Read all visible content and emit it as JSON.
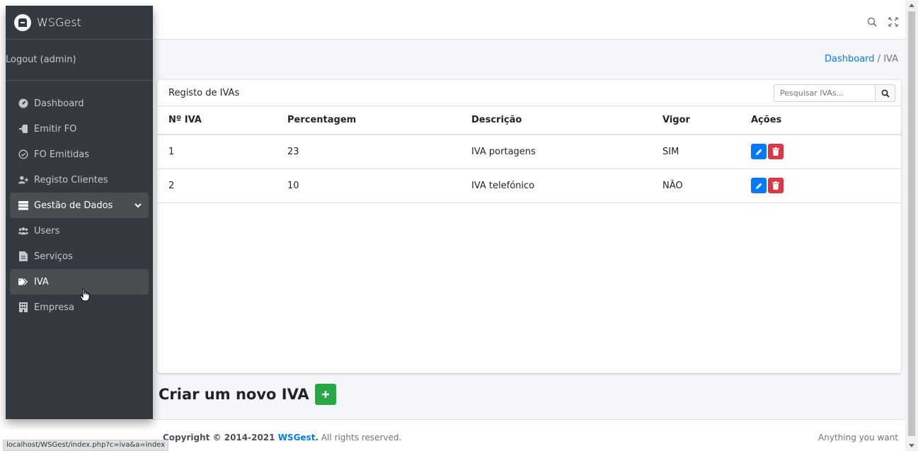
{
  "brand": {
    "name": "WSGest"
  },
  "user": {
    "logout_label": "Logout (admin)"
  },
  "sidebar": {
    "items": [
      {
        "label": "Dashboard",
        "icon": "dashboard-gauge-icon"
      },
      {
        "label": "Emitir FO",
        "icon": "sign-in-icon"
      },
      {
        "label": "FO Emitidas",
        "icon": "check-circle-icon"
      },
      {
        "label": "Registo Clientes",
        "icon": "user-plus-icon"
      },
      {
        "label": "Gestão de Dados",
        "icon": "server-icon"
      },
      {
        "label": "Users",
        "icon": "users-icon"
      },
      {
        "label": "Serviços",
        "icon": "file-icon"
      },
      {
        "label": "IVA",
        "icon": "tags-icon"
      },
      {
        "label": "Empresa",
        "icon": "building-icon"
      }
    ]
  },
  "breadcrumb": {
    "home": "Dashboard",
    "separator": "/",
    "current": "IVA"
  },
  "card": {
    "title": "Registo de IVAs",
    "search_placeholder": "Pesquisar IVAs..."
  },
  "table": {
    "headers": [
      "Nº IVA",
      "Percentagem",
      "Descrição",
      "Vigor",
      "Ações"
    ],
    "rows": [
      {
        "num": "1",
        "pct": "23",
        "desc": "IVA portagens",
        "vigor": "SIM"
      },
      {
        "num": "2",
        "pct": "10",
        "desc": "IVA telefónico",
        "vigor": "NÃO"
      }
    ]
  },
  "create": {
    "title": "Criar um novo IVA"
  },
  "footer": {
    "copyright_prefix": "Copyright © 2014-2021",
    "brand_link": "WSGest",
    "suffix": "All rights reserved.",
    "right_text": "Anything you want"
  },
  "status_url": "localhost/WSGest/index.php?c=iva&a=index",
  "colors": {
    "sidebar_bg": "#343a40",
    "primary": "#007bff",
    "danger": "#dc3545",
    "success": "#28a745",
    "content_bg": "#f4f6f9"
  }
}
